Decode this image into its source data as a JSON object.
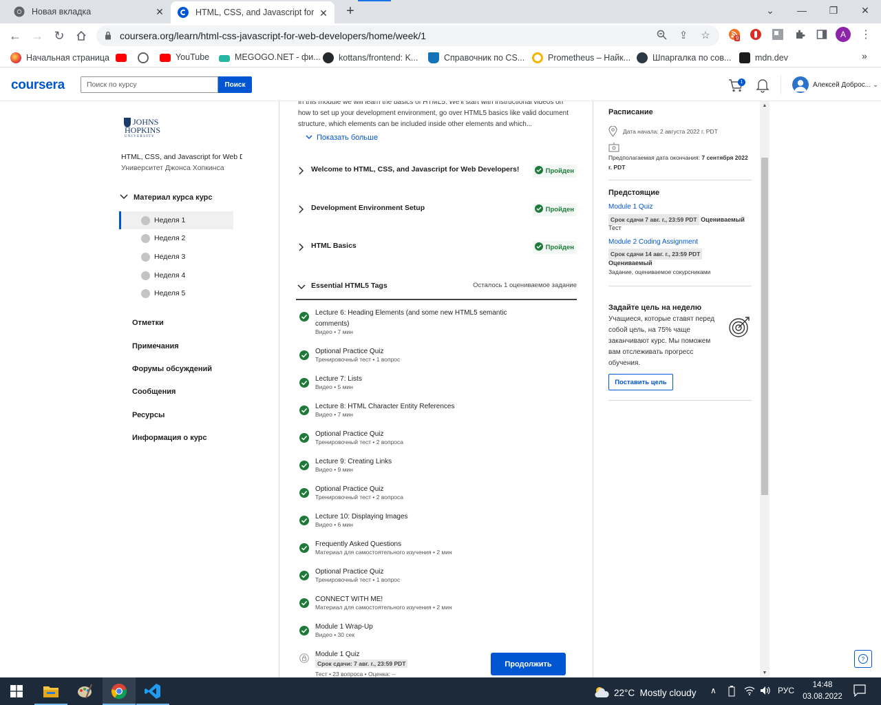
{
  "browser": {
    "tabs": [
      {
        "title": "Новая вкладка",
        "icon": "chrome-icon"
      },
      {
        "title": "HTML, CSS, and Javascript for Web Developers",
        "icon": "coursera-icon"
      }
    ],
    "url": "coursera.org/learn/html-css-javascript-for-web-developers/home/week/1",
    "extension_badge": "9",
    "profile_initial": "A",
    "bookmarks": [
      {
        "label": "Начальная страница",
        "color": "#e94235"
      },
      {
        "label": "",
        "color": "#ff0000"
      },
      {
        "label": "",
        "color": "#5f6368"
      },
      {
        "label": "YouTube",
        "color": "#ff0000"
      },
      {
        "label": "MEGOGO.NET - фи...",
        "color": "#27b5a4"
      },
      {
        "label": "kottans/frontend: K...",
        "color": "#24292e"
      },
      {
        "label": "Справочник по CS...",
        "color": "#1572b6"
      },
      {
        "label": "Prometheus – Найк...",
        "color": "#f4b400"
      },
      {
        "label": "Шпаргалка по сов...",
        "color": "#2d3a45"
      },
      {
        "label": "mdn.dev",
        "color": "#1b1b1b"
      }
    ]
  },
  "header": {
    "logo": "coursera",
    "search_placeholder": "Поиск по курсу",
    "search_button": "Поиск",
    "cart_count": "1",
    "username": "Алексей Доброс..."
  },
  "sidebar": {
    "university_logo": {
      "line1": "JOHNS",
      "line2": "HOPKINS",
      "line3": "UNIVERSITY"
    },
    "course_name": "HTML, CSS, and Javascript for Web Developers",
    "university": "Университет Джонса Хопкинса",
    "material_label": "Материал курса курс",
    "weeks": [
      "Неделя 1",
      "Неделя 2",
      "Неделя 3",
      "Неделя 4",
      "Неделя 5"
    ],
    "links": [
      "Отметки",
      "Примечания",
      "Форумы обсуждений",
      "Сообщения",
      "Ресурсы",
      "Информация о курс"
    ]
  },
  "main": {
    "intro": "In this module we will learn the basics of HTML5. We'll start with instructional videos on how to set up your development environment, go over HTML5 basics like valid document structure, which elements can be included inside other elements and which...",
    "show_more": "Показать больше",
    "lessons": [
      {
        "title": "Welcome to HTML, CSS, and Javascript for Web Developers!",
        "status": "Пройден"
      },
      {
        "title": "Development Environment Setup",
        "status": "Пройден"
      },
      {
        "title": "HTML Basics",
        "status": "Пройден"
      }
    ],
    "essential": {
      "title": "Essential HTML5 Tags",
      "remaining": "Осталось 1 оцениваемое задание"
    },
    "items": [
      {
        "title": "Lecture 6: Heading Elements (and some new HTML5 semantic comments)",
        "meta": "Видео • 7 мин"
      },
      {
        "title": "Optional Practice Quiz",
        "meta": "Тренировочный тест • 1 вопрос"
      },
      {
        "title": "Lecture 7: Lists",
        "meta": "Видео • 5 мин"
      },
      {
        "title": "Lecture 8: HTML Character Entity References",
        "meta": "Видео • 7 мин"
      },
      {
        "title": "Optional Practice Quiz",
        "meta": "Тренировочный тест • 2 вопроса"
      },
      {
        "title": "Lecture 9: Creating Links",
        "meta": "Видео • 9 мин"
      },
      {
        "title": "Optional Practice Quiz",
        "meta": "Тренировочный тест • 2 вопроса"
      },
      {
        "title": "Lecture 10: Displaying Images",
        "meta": "Видео • 6 мин"
      },
      {
        "title": "Frequently Asked Questions",
        "meta": "Материал для самостоятельного изучения • 2 мин"
      },
      {
        "title": "Optional Practice Quiz",
        "meta": "Тренировочный тест • 1 вопрос"
      },
      {
        "title": "CONNECT WITH ME!",
        "meta": "Материал для самостоятельного изучения • 2 мин"
      },
      {
        "title": "Module 1 Wrap-Up",
        "meta": "Видео • 30 сек"
      }
    ],
    "quiz": {
      "title": "Module 1 Quiz",
      "due": "Срок сдачи: 7 авг. г., 23:59 PDT",
      "meta": "Тест • 23 вопроса • Оценка: --"
    },
    "continue_button": "Продолжить"
  },
  "right": {
    "schedule_title": "Расписание",
    "start_date": "Дата начала: 2 августа 2022 г. PDT",
    "end_label": "Предполагаемая дата окончания: ",
    "end_date": "7 сентября 2022 г. PDT",
    "upcoming_title": "Предстоящие",
    "upcoming": [
      {
        "link": "Module 1 Quiz",
        "due": "Срок сдачи 7 авг. г., 23:59 PDT",
        "graded": "Оцениваемый",
        "kind": "Тест"
      },
      {
        "link": "Module 2 Coding Assignment",
        "due": "Срок сдачи 14 авг. г., 23:59 PDT",
        "graded": "Оцениваемый",
        "kind": "Задание, оцениваемое сокурсниками"
      }
    ],
    "goal_title": "Задайте цель на неделю",
    "goal_text": "Учащиеся, которые ставят перед собой цель, на 75% чаще заканчивают курс. Мы поможем вам отслеживать прогресс обучения.",
    "goal_button": "Поставить цель"
  },
  "taskbar": {
    "weather": "22°C  Mostly cloudy",
    "lang": "РУС",
    "time": "14:48",
    "date": "03.08.2022"
  },
  "colors": {
    "brand": "#0056d2",
    "passed": "#1e7a3a",
    "taskbar": "#1c2a3a"
  }
}
